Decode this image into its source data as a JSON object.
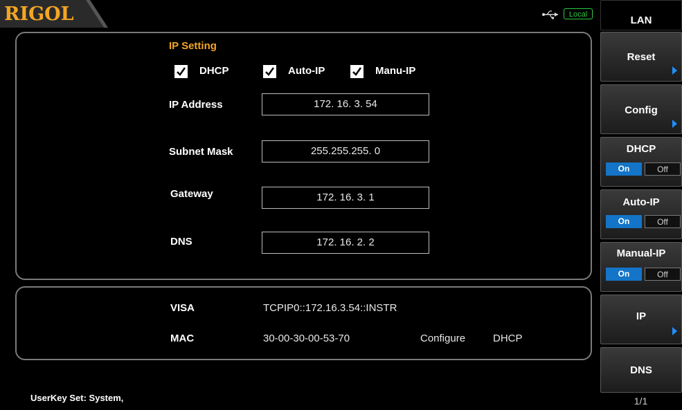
{
  "header": {
    "logo": "RIGOL",
    "status_badge": "Local",
    "usb_icon": "usb-icon"
  },
  "ip_setting": {
    "title": "IP Setting",
    "title_color": "#f4a623",
    "checkboxes": [
      {
        "label": "DHCP",
        "checked": true
      },
      {
        "label": "Auto-IP",
        "checked": true
      },
      {
        "label": "Manu-IP",
        "checked": true
      }
    ],
    "fields": [
      {
        "label": "IP Address",
        "value": "172. 16.  3. 54"
      },
      {
        "label": "Subnet Mask",
        "value": "255.255.255.  0"
      },
      {
        "label": "Gateway",
        "value": "172. 16.  3.  1"
      },
      {
        "label": "DNS",
        "value": "172. 16.  2.  2"
      }
    ]
  },
  "info": {
    "visa_label": "VISA",
    "visa_value": "TCPIP0::172.16.3.54::INSTR",
    "mac_label": "MAC",
    "mac_value": "30-00-30-00-53-70",
    "configure_label": "Configure",
    "configure_value": "DHCP"
  },
  "menu": {
    "title": "LAN",
    "items": [
      {
        "label": "Reset",
        "has_arrow": true
      },
      {
        "label": "Config",
        "has_arrow": true
      },
      {
        "label": "DHCP",
        "on": "On",
        "off": "Off",
        "state": "On"
      },
      {
        "label": "Auto-IP",
        "on": "On",
        "off": "Off",
        "state": "On"
      },
      {
        "label": "Manual-IP",
        "on": "On",
        "off": "Off",
        "state": "On"
      },
      {
        "label": "IP",
        "has_arrow": true
      },
      {
        "label": "DNS",
        "has_arrow": false
      }
    ],
    "page": "1/1",
    "accent": "#1474c7"
  },
  "footer": {
    "userkey": "UserKey Set:   System,"
  }
}
